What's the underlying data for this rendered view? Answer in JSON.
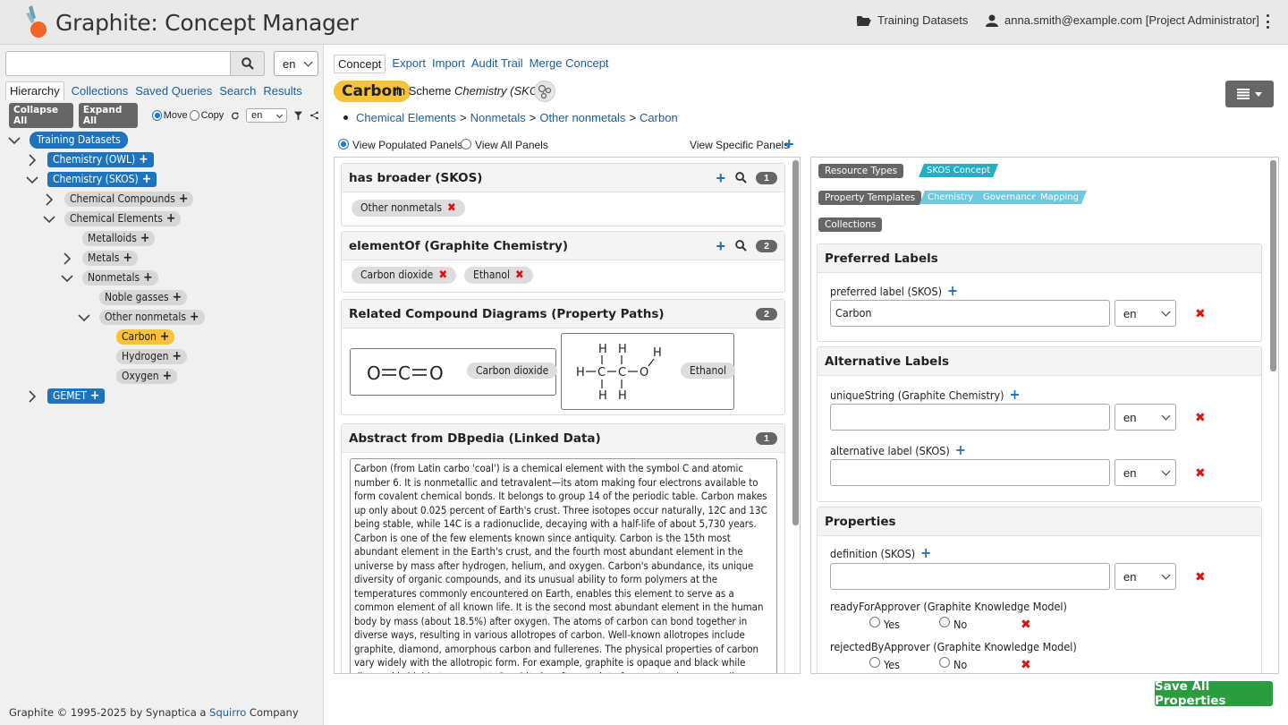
{
  "header": {
    "title": "Graphite: Concept Manager",
    "datasets_label": "Training Datasets",
    "user_label": "anna.smith@example.com [Project Administrator]"
  },
  "left": {
    "search": {
      "value": "",
      "placeholder": ""
    },
    "lang": "en",
    "tabs": [
      "Hierarchy",
      "Collections",
      "Saved Queries",
      "Search",
      "Results"
    ],
    "toolbar": {
      "collapse": "Collapse All",
      "expand": "Expand All",
      "move": "Move",
      "copy": "Copy",
      "lang": "en"
    },
    "tree": {
      "root": "Training Datasets",
      "owl": "Chemistry (OWL)",
      "skos": "Chemistry (SKOS)",
      "compounds": "Chemical Compounds",
      "elements": "Chemical Elements",
      "metalloids": "Metalloids",
      "metals": "Metals",
      "nonmetals": "Nonmetals",
      "noble": "Noble gasses",
      "other": "Other nonmetals",
      "carbon": "Carbon",
      "hydrogen": "Hydrogen",
      "oxygen": "Oxygen",
      "gemet": "GEMET"
    },
    "footer": {
      "prefix": "Graphite © 1995-2025 by Synaptica a ",
      "link": "Squirro",
      "suffix": " Company"
    }
  },
  "main": {
    "tabs": [
      "Concept",
      "Export",
      "Import",
      "Audit Trail",
      "Merge Concept"
    ],
    "concept": "Carbon",
    "scheme_prefix": "in Scheme ",
    "scheme_name": "Chemistry (SKOS)",
    "breadcrumb": [
      "Chemical Elements",
      "Nonmetals",
      "Other nonmetals",
      "Carbon"
    ],
    "view": {
      "populated": "View Populated Panels",
      "all": "View All Panels",
      "specific": "View Specific Panels"
    },
    "panels": {
      "broader": {
        "title": "has broader (SKOS)",
        "count": "1",
        "chips": [
          "Other nonmetals"
        ]
      },
      "element_of": {
        "title": "elementOf (Graphite Chemistry)",
        "count": "2",
        "chips": [
          "Carbon dioxide",
          "Ethanol"
        ]
      },
      "diagrams": {
        "title": "Related Compound Diagrams (Property Paths)",
        "count": "2",
        "labels": [
          "Carbon dioxide",
          "Ethanol"
        ]
      },
      "abstract": {
        "title": "Abstract from DBpedia (Linked Data)",
        "count": "1",
        "text": "Carbon (from Latin carbo 'coal') is a chemical element with the symbol C and atomic number 6. It is nonmetallic and tetravalent—its atom making four electrons available to form covalent chemical bonds. It belongs to group 14 of the periodic table. Carbon makes up only about 0.025 percent of Earth's crust. Three isotopes occur naturally, 12C and 13C being stable, while 14C is a radionuclide, decaying with a half-life of about 5,730 years. Carbon is one of the few elements known since antiquity. Carbon is the 15th most abundant element in the Earth's crust, and the fourth most abundant element in the universe by mass after hydrogen, helium, and oxygen. Carbon's abundance, its unique diversity of organic compounds, and its unusual ability to form polymers at the temperatures commonly encountered on Earth, enables this element to serve as a common element of all known life. It is the second most abundant element in the human body by mass (about 18.5%) after oxygen. The atoms of carbon can bond together in diverse ways, resulting in various allotropes of carbon. Well-known allotropes include graphite, diamond, amorphous carbon and fullerenes. The physical properties of carbon vary widely with the allotropic form. For example, graphite is opaque and black while diamond is highly transparent. Graphite is soft enough to form a streak on paper (hence its name, from the Greek verb \"γράφειν\" which means \"to write\"), while diamond is the hardest naturally occurring material known."
      }
    }
  },
  "right": {
    "tags": {
      "resource_types": "Resource Types",
      "property_templates": "Property Templates",
      "collections": "Collections"
    },
    "resource_type_value": "SKOS Concept",
    "templates": [
      "Chemistry",
      "Governance",
      "Mapping"
    ],
    "preferred": {
      "title": "Preferred Labels",
      "field": "preferred label (SKOS)",
      "value": "Carbon",
      "lang": "en"
    },
    "alternative": {
      "title": "Alternative Labels",
      "unique": "uniqueString (Graphite Chemistry)",
      "alt": "alternative label (SKOS)",
      "lang": "en"
    },
    "properties": {
      "title": "Properties",
      "definition": "definition (SKOS)",
      "lang": "en",
      "ready": "readyForApprover (Graphite Knowledge Model)",
      "rejected": "rejectedByApprover (Graphite Knowledge Model)",
      "yes": "Yes",
      "no": "No"
    },
    "save": "Save All Properties"
  },
  "colors": {
    "accent": "#1e73be",
    "selected": "#f8c13a",
    "save": "#2a9d3f",
    "remove": "#dd1111",
    "template": "#6fc8e0",
    "resource": "#1fb0c8"
  }
}
